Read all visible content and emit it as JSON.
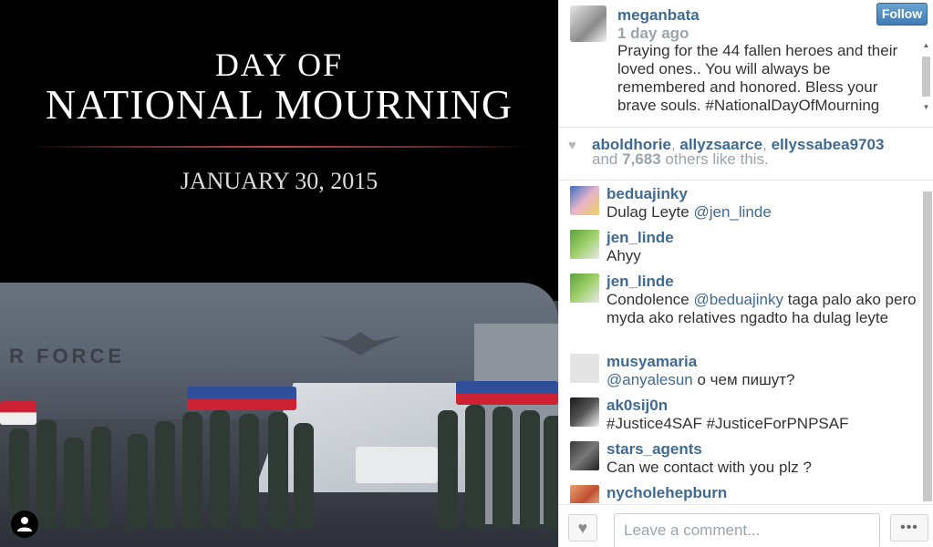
{
  "photo": {
    "title_line1": "DAY OF",
    "title_line2": "NATIONAL MOURNING",
    "date": "JANUARY 30, 2015",
    "airforce_text": "R FORCE"
  },
  "post": {
    "owner": "meganbata",
    "time": "1 day ago",
    "follow_label": "Follow",
    "caption": "Praying for the 44 fallen heroes and their loved ones.. You will always be remembered and honored. Bless your brave souls. #NationalDayOfMourning"
  },
  "likes": {
    "liker1": "aboldhorie",
    "liker2": "allyzsaarce",
    "liker3": "ellyssabea9703",
    "and_text": "and",
    "count": "7,683",
    "others_text": "others like this."
  },
  "comments": [
    {
      "user": "beduajinky",
      "pre": "Dulag Leyte ",
      "mention": "@jen_linde",
      "post": ""
    },
    {
      "user": "jen_linde",
      "pre": "Ahyy",
      "mention": "",
      "post": ""
    },
    {
      "user": "jen_linde",
      "pre": "Condolence ",
      "mention": "@beduajinky",
      "post": " taga palo ako pero myda ako relatives ngadto ha dulag leyte"
    },
    {
      "user": "musyamaria",
      "pre": "",
      "mention": "@anyalesun",
      "post": " о чем пишут?"
    },
    {
      "user": "ak0sij0n",
      "pre": "#Justice4SAF #JusticeForPNPSAF",
      "mention": "",
      "post": ""
    },
    {
      "user": "stars_agents",
      "pre": "Can we contact with you plz ?",
      "mention": "",
      "post": ""
    },
    {
      "user": "nycholehepburn",
      "pre": "",
      "mention": "",
      "post": ""
    }
  ],
  "footer": {
    "comment_placeholder": "Leave a comment...",
    "more_label": "•••",
    "like_icon": "heart-icon"
  },
  "colors": {
    "link": "#3f6a94",
    "muted": "#9aa4ad",
    "follow_button": "#4f8ac2"
  }
}
